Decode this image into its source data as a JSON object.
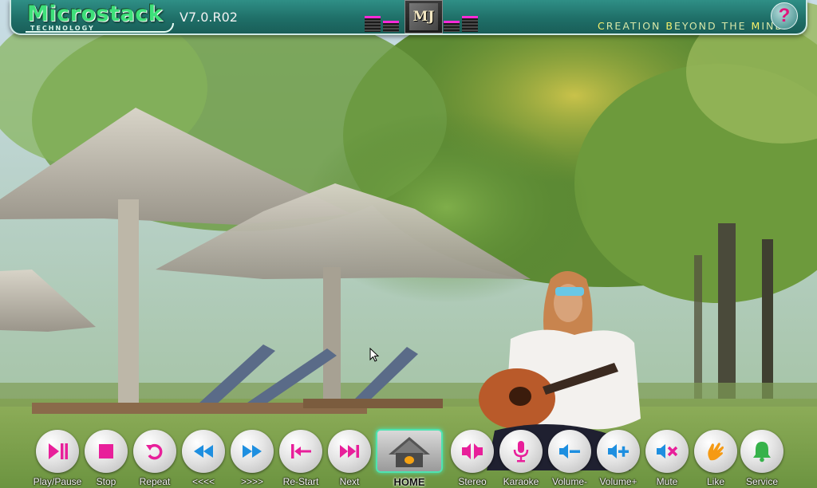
{
  "app": {
    "logo_text": "Microstack",
    "logo_subtext": "TECHNOLOGY",
    "version": "V7.0.R02",
    "tagline_parts": [
      "C",
      "REATION ",
      "B",
      "EYOND THE ",
      "M",
      "IND"
    ],
    "help_label": "?",
    "mj_badge": "MJ"
  },
  "colors": {
    "magenta": "#e81f9a",
    "blue": "#1e8fe0",
    "orange": "#f59a14",
    "green": "#36b24a",
    "accent": "#4fe3b0"
  },
  "controls": [
    {
      "id": "play-pause",
      "label": "Play/Pause",
      "icon": "play-pause-icon"
    },
    {
      "id": "stop",
      "label": "Stop",
      "icon": "stop-icon"
    },
    {
      "id": "repeat",
      "label": "Repeat",
      "icon": "repeat-icon"
    },
    {
      "id": "rewind",
      "label": "<<<<",
      "icon": "rewind-icon"
    },
    {
      "id": "forward",
      "label": ">>>>",
      "icon": "fast-forward-icon"
    },
    {
      "id": "restart",
      "label": "Re-Start",
      "icon": "restart-icon"
    },
    {
      "id": "next",
      "label": "Next",
      "icon": "next-icon"
    },
    {
      "id": "home",
      "label": "HOME",
      "icon": "home-icon"
    },
    {
      "id": "stereo",
      "label": "Stereo",
      "icon": "stereo-speaker-icon"
    },
    {
      "id": "karaoke",
      "label": "Karaoke",
      "icon": "microphone-icon"
    },
    {
      "id": "volume-down",
      "label": "Volume-",
      "icon": "volume-down-icon"
    },
    {
      "id": "volume-up",
      "label": "Volume+",
      "icon": "volume-up-icon"
    },
    {
      "id": "mute",
      "label": "Mute",
      "icon": "mute-icon"
    },
    {
      "id": "like",
      "label": "Like",
      "icon": "like-hand-icon"
    },
    {
      "id": "service",
      "label": "Service",
      "icon": "bell-icon"
    }
  ]
}
